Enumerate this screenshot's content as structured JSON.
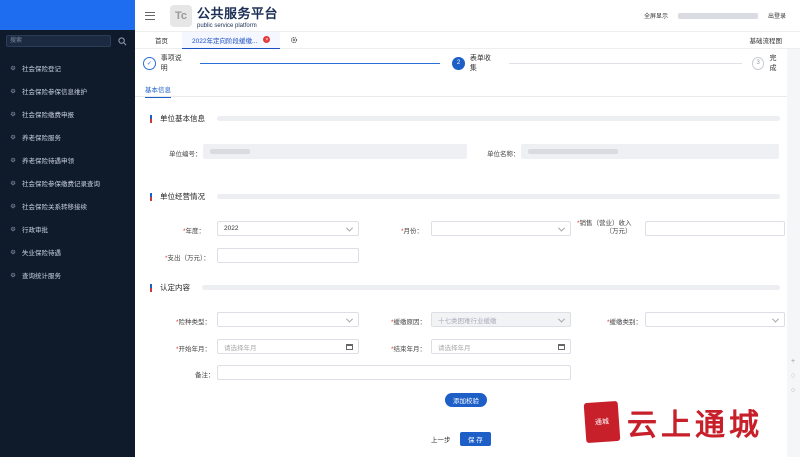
{
  "sidebar": {
    "search_placeholder": "搜索",
    "items": [
      {
        "label": "社会保险登记"
      },
      {
        "label": "社会保险参保信息维护"
      },
      {
        "label": "社会保险缴费申报"
      },
      {
        "label": "养老保险服务"
      },
      {
        "label": "养老保险待遇申领"
      },
      {
        "label": "社会保险参保缴费记录查询"
      },
      {
        "label": "社会保险关系转移接续"
      },
      {
        "label": "行政审批"
      },
      {
        "label": "失业保险待遇"
      },
      {
        "label": "查询统计服务"
      }
    ]
  },
  "header": {
    "title": "公共服务平台",
    "subtitle": "public service platform",
    "logo_letter": "Tc",
    "fullscreen": "全屏显示",
    "logout": "出登录"
  },
  "tabs": {
    "home": "首页",
    "active": "2022年定向阶段缓缴...",
    "close": "×",
    "right_link": "基础流程图"
  },
  "steps": [
    {
      "number": "✓",
      "label": "事项说明"
    },
    {
      "number": "2",
      "label": "表单收集"
    },
    {
      "number": "3",
      "label": "完成"
    }
  ],
  "subtab": "基本信息",
  "sections": {
    "basic": "单位基本信息",
    "operation": "单位经营情况",
    "content": "认定内容"
  },
  "fields": {
    "unit_code_label": "单位编号：",
    "unit_name_label": "单位名称：",
    "year_label": "年度：",
    "year_value": "2022",
    "month_label": "月份：",
    "sales_label_1": "销售（营业）收入",
    "sales_label_2": "（万元）",
    "expense_label": "支出（万元）：",
    "insurance_type_label": "险种类型：",
    "defer_reason_label": "缓缴原因：",
    "defer_reason_value": "十七类困难行业缓缴",
    "defer_category_label": "缓缴类别：",
    "start_label": "开始年月：",
    "start_placeholder": "请选择年月",
    "end_label": "结束年月：",
    "end_placeholder": "请选择年月",
    "remark_label": "备注：",
    "required_mark": "*"
  },
  "buttons": {
    "add_check": "添加校验",
    "prev": "上一步",
    "save": "保 存"
  },
  "watermark": {
    "text": "云上通城",
    "seal": "通城"
  },
  "colors": {
    "primary": "#1e5fc7",
    "sidebar_bg": "#0f1a2b",
    "logo_bg": "#1e6cf0",
    "danger": "#e23a3a",
    "watermark": "#c8202a"
  }
}
